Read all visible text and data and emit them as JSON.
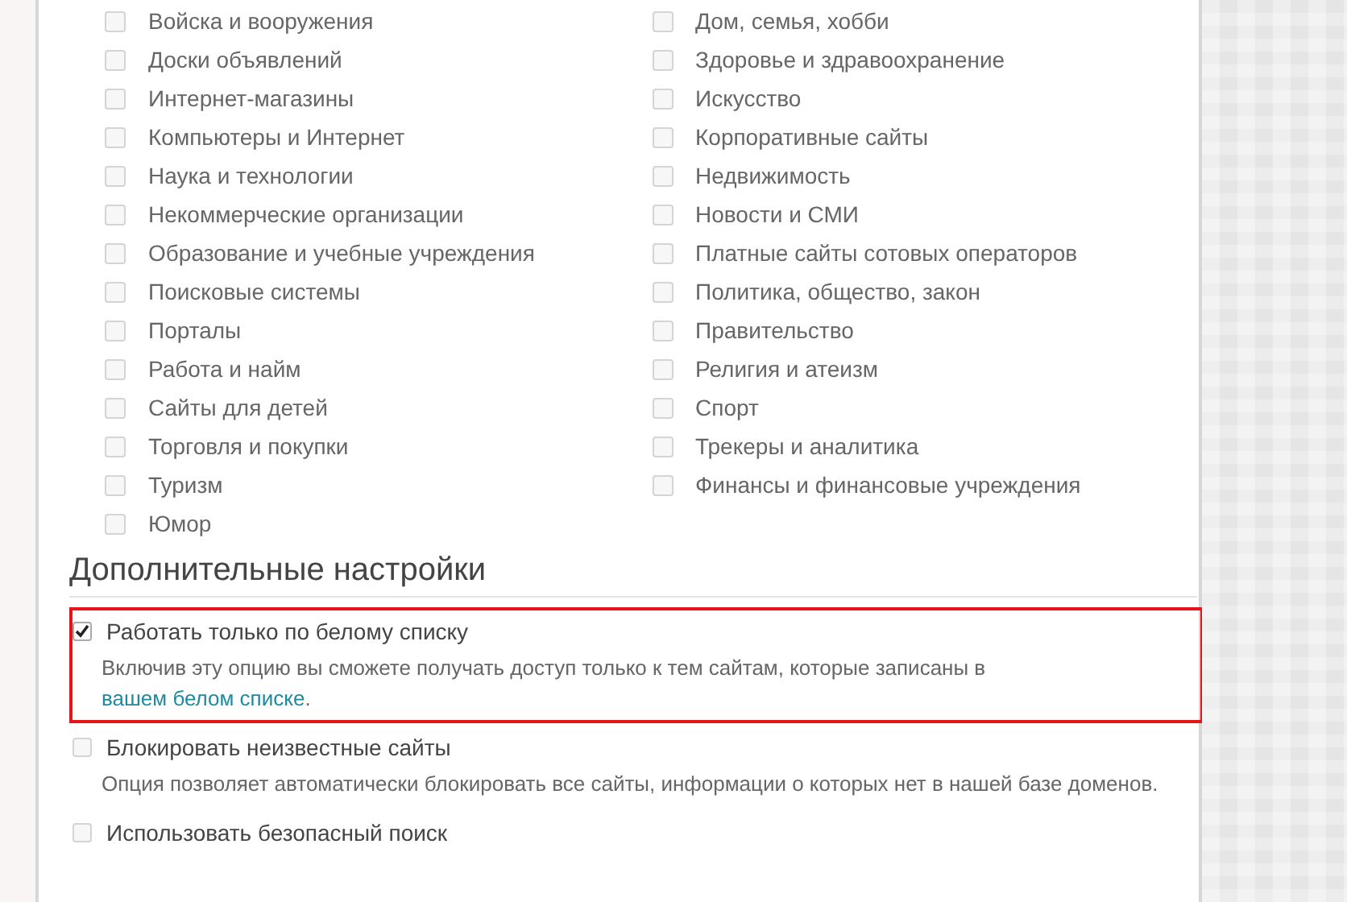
{
  "categories": {
    "columns": [
      [
        {
          "label": "Войска и вооружения",
          "checked": false
        },
        {
          "label": "Доски объявлений",
          "checked": false
        },
        {
          "label": "Интернет-магазины",
          "checked": false
        },
        {
          "label": "Компьютеры и Интернет",
          "checked": false
        },
        {
          "label": "Наука и технологии",
          "checked": false
        },
        {
          "label": "Некоммерческие организации",
          "checked": false
        },
        {
          "label": "Образование и учебные учреждения",
          "checked": false
        },
        {
          "label": "Поисковые системы",
          "checked": false
        },
        {
          "label": "Порталы",
          "checked": false
        },
        {
          "label": "Работа и найм",
          "checked": false
        },
        {
          "label": "Сайты для детей",
          "checked": false
        },
        {
          "label": "Торговля и покупки",
          "checked": false
        },
        {
          "label": "Туризм",
          "checked": false
        },
        {
          "label": "Юмор",
          "checked": false
        }
      ],
      [
        {
          "label": "Дом, семья, хобби",
          "checked": false
        },
        {
          "label": "Здоровье и здравоохранение",
          "checked": false
        },
        {
          "label": "Искусство",
          "checked": false
        },
        {
          "label": "Корпоративные сайты",
          "checked": false
        },
        {
          "label": "Недвижимость",
          "checked": false
        },
        {
          "label": "Новости и СМИ",
          "checked": false
        },
        {
          "label": "Платные сайты сотовых операторов",
          "checked": false
        },
        {
          "label": "Политика, общество, закон",
          "checked": false
        },
        {
          "label": "Правительство",
          "checked": false
        },
        {
          "label": "Религия и атеизм",
          "checked": false
        },
        {
          "label": "Спорт",
          "checked": false
        },
        {
          "label": "Трекеры и аналитика",
          "checked": false
        },
        {
          "label": "Финансы и финансовые учреждения",
          "checked": false
        }
      ]
    ]
  },
  "extra_settings": {
    "heading": "Дополнительные настройки",
    "options": [
      {
        "label": "Работать только по белому списку",
        "checked": true,
        "highlighted": true,
        "description": {
          "text": "Включив эту опцию вы сможете получать доступ только к тем сайтам, которые записаны в",
          "link": "вашем белом списке",
          "after": "."
        }
      },
      {
        "label": "Блокировать неизвестные сайты",
        "checked": false,
        "highlighted": false,
        "description": {
          "text": "Опция позволяет автоматически блокировать все сайты, информации о которых нет в нашей базе доменов."
        }
      },
      {
        "label": "Использовать безопасный поиск",
        "checked": false,
        "highlighted": false
      }
    ]
  }
}
